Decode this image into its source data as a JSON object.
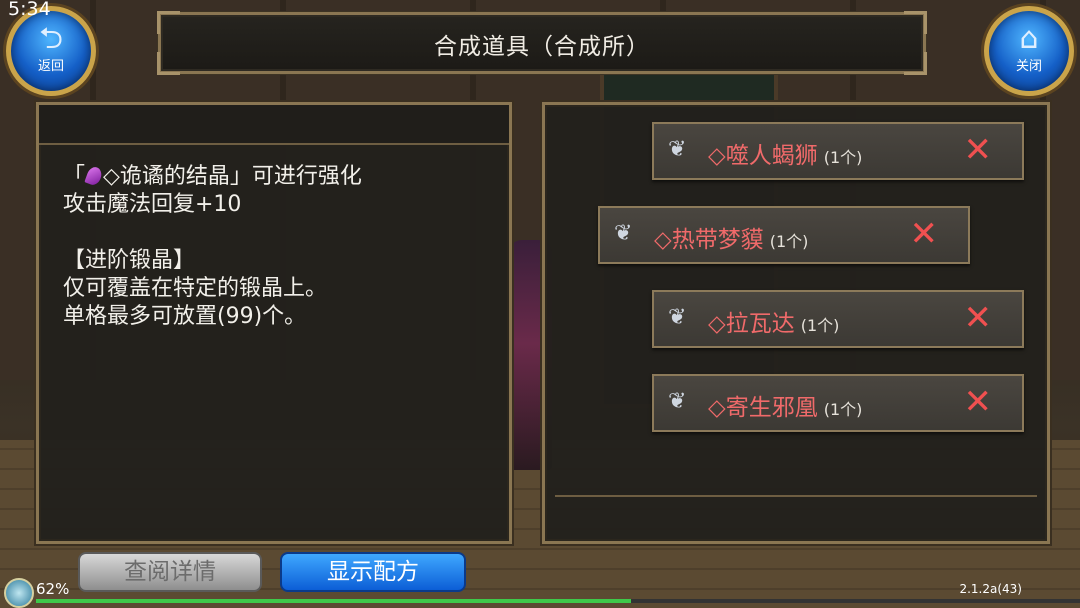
{
  "status": {
    "clock": "5:34",
    "battery_percent": "62%",
    "version": "2.1.2a(43)",
    "progress_fraction": 0.57
  },
  "header": {
    "title": "合成道具（合成所）",
    "back_label": "返回",
    "close_label": "关闭"
  },
  "info": {
    "lines": [
      "「◇诡谲的结晶」可进行强化",
      "攻击魔法回复+10",
      "",
      "【进阶锻晶】",
      "仅可覆盖在特定的锻晶上。",
      "单格最多可放置(99)个。"
    ],
    "line1_prefix": "「",
    "line1_suffix": "◇诡谲的结晶」可进行强化"
  },
  "materials": [
    {
      "name": "◇噬人蝎狮",
      "qty": "(1个)"
    },
    {
      "name": "◇热带梦貘",
      "qty": "(1个)"
    },
    {
      "name": "◇拉瓦达",
      "qty": "(1个)"
    },
    {
      "name": "◇寄生邪凰",
      "qty": "(1个)"
    }
  ],
  "buttons": {
    "detail": "查阅详情",
    "recipe": "显示配方"
  },
  "icons": {
    "back": "back-arrow-icon",
    "close": "home-icon",
    "item": "feather-icon",
    "remove": "close-x-icon",
    "gem": "crystal-icon"
  },
  "colors": {
    "item_name": "#f06a6a",
    "remove": "#f05050",
    "accent_blue": "#1560c8"
  }
}
